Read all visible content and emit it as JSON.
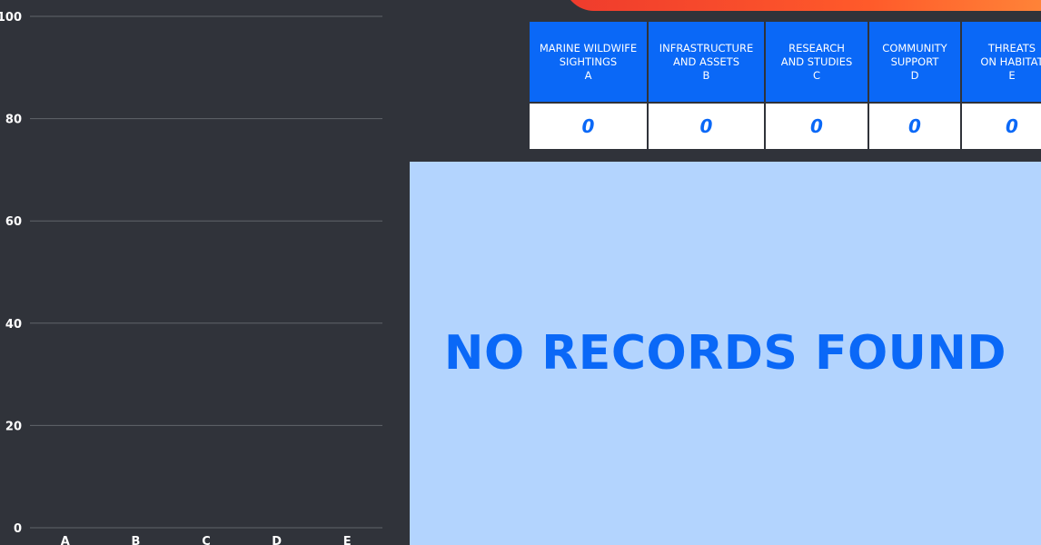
{
  "chart_data": {
    "type": "bar",
    "categories": [
      "A",
      "B",
      "C",
      "D",
      "E"
    ],
    "values": [
      0,
      0,
      0,
      0,
      0
    ],
    "ylim": [
      0,
      100
    ],
    "yticks": [
      "0",
      "20",
      "40",
      "60",
      "80",
      "100"
    ],
    "grid": true,
    "colors": {
      "gridline": "#60646b",
      "ticklabel": "#ffffff"
    }
  },
  "summary": {
    "columns": [
      {
        "title_lines": [
          "MARINE WILDWIFE",
          "SIGHTINGS"
        ],
        "code": "A",
        "value": "0"
      },
      {
        "title_lines": [
          "INFRASTRUCTURE",
          "AND ASSETS"
        ],
        "code": "B",
        "value": "0"
      },
      {
        "title_lines": [
          "RESEARCH",
          "AND STUDIES"
        ],
        "code": "C",
        "value": "0"
      },
      {
        "title_lines": [
          "COMMUNITY",
          "SUPPORT"
        ],
        "code": "D",
        "value": "0"
      },
      {
        "title_lines": [
          "THREATS",
          "ON HABITAT"
        ],
        "code": "E",
        "value": "0"
      }
    ]
  },
  "empty_state": {
    "message": "NO RECORDS FOUND"
  },
  "colors": {
    "background": "#30333a",
    "accent": "#0a68f7",
    "empty_panel": "#b3d4fe",
    "banner_start": "#ef3b2d",
    "banner_end": "#ff8a3a"
  }
}
